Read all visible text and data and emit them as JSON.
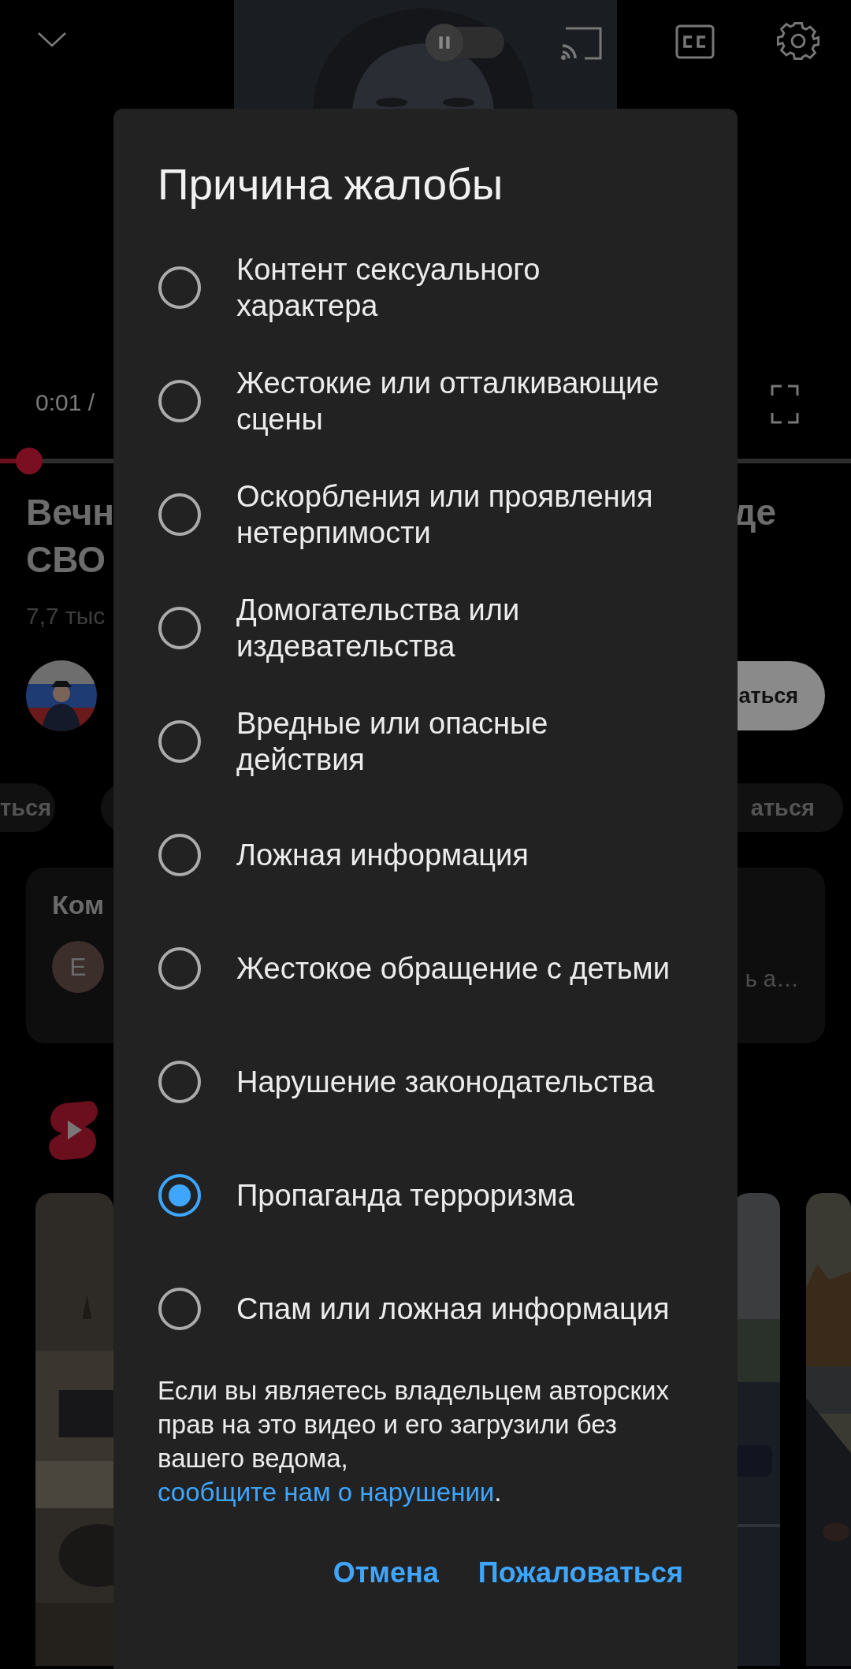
{
  "player": {
    "autoplay": {
      "on": false
    },
    "time": "0:01 /",
    "progress": {
      "level": 0.034
    }
  },
  "video": {
    "title_lines": [
      "Вечн",
      "СВО"
    ],
    "title_right": "де",
    "views": "7,7 тыс",
    "subscribe": "аться"
  },
  "chips": {
    "left": "ться",
    "right": "аться"
  },
  "comments": {
    "title": "Ком",
    "avatar_letter": "E",
    "preview": "ь а…"
  },
  "dialog": {
    "title": "Причина жалобы",
    "options": [
      {
        "label": "Контент сексуального характера",
        "selected": false
      },
      {
        "label": "Жестокие или отталкивающие сцены",
        "selected": false
      },
      {
        "label": "Оскорбления или проявления нетерпимости",
        "selected": false
      },
      {
        "label": "Домогательства или издевательства",
        "selected": false
      },
      {
        "label": "Вредные или опасные действия",
        "selected": false
      },
      {
        "label": "Ложная информация",
        "selected": false
      },
      {
        "label": "Жестокое обращение с детьми",
        "selected": false
      },
      {
        "label": "Нарушение законодательства",
        "selected": false
      },
      {
        "label": "Пропаганда терроризма",
        "selected": true
      },
      {
        "label": "Спам или ложная информация",
        "selected": false
      }
    ],
    "notice": {
      "text": "Если вы являетесь владельцем авторских прав на это видео и его загрузили без вашего ведома, ",
      "link": "сообщите нам о нарушении",
      "after": "."
    },
    "buttons": [
      "Отмена",
      "Пожаловаться"
    ]
  }
}
